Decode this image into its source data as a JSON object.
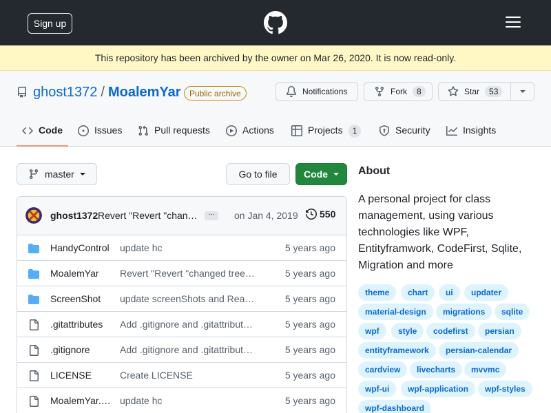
{
  "header": {
    "signup_label": "Sign up",
    "logo_icon": "github-logo-icon",
    "menu_icon": "hamburger-menu-icon"
  },
  "banner": {
    "text": "This repository has been archived by the owner on Mar 26, 2020. It is now read-only."
  },
  "repo": {
    "owner": "ghost1372",
    "separator": "/",
    "name": "MoalemYar",
    "archive_badge": "Public archive",
    "notifications_label": "Notifications",
    "fork_label": "Fork",
    "fork_count": "8",
    "star_label": "Star",
    "star_count": "53"
  },
  "tabs": [
    {
      "label": "Code",
      "icon": "code-icon",
      "active": true
    },
    {
      "label": "Issues",
      "icon": "issue-icon"
    },
    {
      "label": "Pull requests",
      "icon": "pull-request-icon"
    },
    {
      "label": "Actions",
      "icon": "play-icon"
    },
    {
      "label": "Projects",
      "icon": "table-icon",
      "count": "1"
    },
    {
      "label": "Security",
      "icon": "shield-icon"
    },
    {
      "label": "Insights",
      "icon": "graph-icon"
    }
  ],
  "toolbar": {
    "branch": "master",
    "goto_file": "Go to file",
    "code": "Code"
  },
  "commit": {
    "author": "ghost1372",
    "message": "Revert \"Revert \"changed treeview style\"\"",
    "ellipsis": "...",
    "date": "on Jan 4, 2019",
    "count": "550"
  },
  "files": [
    {
      "name": "HandyControl",
      "type": "folder",
      "message": "update hc",
      "age": "5 years ago"
    },
    {
      "name": "MoalemYar",
      "type": "folder",
      "message": "Revert \"Revert \"changed treeview style\"\"",
      "age": "5 years ago"
    },
    {
      "name": "ScreenShot",
      "type": "folder",
      "message": "update screenShots and Readme",
      "age": "5 years ago"
    },
    {
      "name": ".gitattributes",
      "type": "file",
      "message": "Add .gitignore and .gitattributes.",
      "age": "5 years ago"
    },
    {
      "name": ".gitignore",
      "type": "file",
      "message": "Add .gitignore and .gitattributes.",
      "age": "5 years ago"
    },
    {
      "name": "LICENSE",
      "type": "file",
      "message": "Create LICENSE",
      "age": "5 years ago"
    },
    {
      "name": "MoalemYar.sln",
      "type": "file",
      "message": "update hc",
      "age": "5 years ago"
    }
  ],
  "about": {
    "title": "About",
    "description": "A personal project for class management, using various technologies like WPF, Entityframwork, CodeFirst, Sqlite, Migration and more",
    "topics": [
      "theme",
      "chart",
      "ui",
      "updater",
      "material-design",
      "migrations",
      "sqlite",
      "wpf",
      "style",
      "codefirst",
      "persian",
      "entityframework",
      "persian-calendar",
      "cardview",
      "livecharts",
      "mvvmc",
      "wpf-ui",
      "wpf-application",
      "wpf-styles",
      "wpf-dashboard"
    ]
  },
  "colors": {
    "header_bg": "#24292f",
    "banner_bg": "#fff8c5",
    "link": "#0969da",
    "primary_button": "#1f883d",
    "topic_bg": "#ddf4ff",
    "active_tab_underline": "#fd8c73",
    "folder_icon": "#54aeff"
  }
}
